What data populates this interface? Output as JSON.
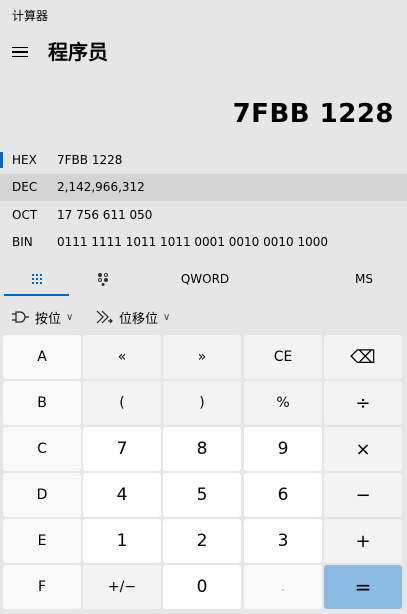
{
  "window": {
    "title": "计算器"
  },
  "header": {
    "mode_title": "程序员"
  },
  "display": {
    "value": "7FBB 1228"
  },
  "radix": [
    {
      "label": "HEX",
      "value": "7FBB 1228"
    },
    {
      "label": "DEC",
      "value": "2,142,966,312"
    },
    {
      "label": "OCT",
      "value": "17 756 611 050"
    },
    {
      "label": "BIN",
      "value": "0111 1111 1011 1011 0001 0010 0010 1000"
    }
  ],
  "tabs": {
    "word_size": "QWORD",
    "memory": "MS"
  },
  "operators": {
    "bitwise": "按位",
    "bitshift": "位移位"
  },
  "keys": [
    [
      "A",
      "«",
      "»",
      "CE",
      "⌫"
    ],
    [
      "B",
      "(",
      ")",
      "%",
      "÷"
    ],
    [
      "C",
      "7",
      "8",
      "9",
      "×"
    ],
    [
      "D",
      "4",
      "5",
      "6",
      "−"
    ],
    [
      "E",
      "1",
      "2",
      "3",
      "+"
    ],
    [
      "F",
      "+/−",
      "0",
      ".",
      "="
    ]
  ],
  "colors": {
    "accent": "#0067c0",
    "equals": "#8bbbe3"
  }
}
